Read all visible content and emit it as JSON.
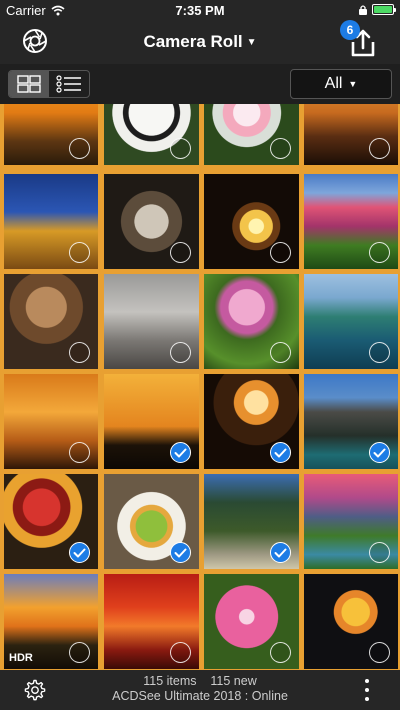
{
  "status": {
    "carrier": "Carrier",
    "time": "7:35 PM"
  },
  "nav": {
    "title": "Camera Roll",
    "share_badge": "6"
  },
  "toolbar": {
    "filter_label": "All"
  },
  "grid": {
    "tiles": [
      {
        "name": "sunset-tree",
        "bg": "linear-gradient(180deg,#f6a523 0%,#e27b14 45%,#5d3612 75%,#2a1b0a 100%)",
        "checked": false
      },
      {
        "name": "panda",
        "bg": "radial-gradient(circle at 50% 45%,#f7f7f4 0 32%,#1d1d1d 33% 40%,#f0f0ec 41% 55%,#2f4a22 56%)",
        "checked": false
      },
      {
        "name": "white-lilies",
        "bg": "radial-gradient(circle at 45% 45%,#fbeaf0 0 18%,#f4a9bd 19% 32%,#d9dfd8 33% 46%,#2b4a1c 47%)",
        "checked": false
      },
      {
        "name": "temple-sunset",
        "bg": "linear-gradient(180deg,#f3a33b 0%,#c76a1f 45%,#5a2d12 70%,#1b0e06 100%)",
        "checked": false
      },
      {
        "name": "golden-pagoda",
        "bg": "linear-gradient(180deg,#1a3a86 0%,#2b56b4 40%,#d79a26 60%,#7a4a13 100%)",
        "checked": false
      },
      {
        "name": "owl",
        "bg": "radial-gradient(circle at 50% 50%,#cfc6b8 0 25%,#5c4c3b 26% 45%,#1f1a15 46%)",
        "checked": false
      },
      {
        "name": "night-fountain",
        "bg": "radial-gradient(circle at 55% 55%,#fff4b0 0 10%,#f3c44a 11% 22%,#6a3a14 23% 32%,#130b06 33%)",
        "checked": false
      },
      {
        "name": "flower-garden",
        "bg": "linear-gradient(180deg,#4a7bc6 0%,#7ea6db 20%,#e05476 35%,#a3346a 55%,#3f7c22 75%,#1e4a15 100%)",
        "checked": false
      },
      {
        "name": "old-man-statue",
        "bg": "radial-gradient(circle at 45% 35%,#b98a5d 0 25%,#6e4a2c 26% 45%,#3a2a1e 46%)",
        "checked": false
      },
      {
        "name": "monkeys",
        "bg": "linear-gradient(180deg,#9a9a98 0%,#c4c2be 40%,#7b7874 70%,#4a4744 100%)",
        "checked": false
      },
      {
        "name": "pink-blossom-tree",
        "bg": "radial-gradient(circle at 45% 35%,#f0a9cf 0 22%,#c55aa0 23% 32%,#3d6a1f 40%,#57902b 70%,#1f3a10 100%)",
        "checked": false
      },
      {
        "name": "coastline-cliffs",
        "bg": "linear-gradient(180deg,#9dc0e0 0%,#7aa8cf 25%,#2e7e73 45%,#1a5b73 70%,#0f3d52 100%)",
        "checked": false
      },
      {
        "name": "sunset-rays",
        "bg": "linear-gradient(180deg,#d97a1a 0%,#f3a83a 40%,#b65c17 70%,#2e1607 100%)",
        "checked": false
      },
      {
        "name": "pointed-building-sunset",
        "bg": "linear-gradient(180deg,#f3b13a 0%,#e4851f 55%,#1c1208 75%,#0c0804 100%)",
        "checked": true
      },
      {
        "name": "sky-lanterns",
        "bg": "radial-gradient(circle at 55% 30%,#ffe1a0 0 14%,#e7902e 15% 26%,#3a1f0c 27% 50%,#150b05 51%)",
        "checked": true
      },
      {
        "name": "karst-cliffs",
        "bg": "linear-gradient(180deg,#3d78c7 0%,#5a8dc9 25%,#4b4b47 40%,#25302a 65%,#1e6c73 85%,#17515a 100%)",
        "checked": true
      },
      {
        "name": "fruit-plate",
        "bg": "radial-gradient(circle at 40% 35%,#d7342e 0 22%,#8c1a14 23% 34%,#e9a22f 35% 48%,#2b1f12 49%)",
        "checked": true
      },
      {
        "name": "salad",
        "bg": "radial-gradient(circle at 50% 55%,#8fbf3c 0 22%,#e5a83e 23% 30%,#f2efe6 31% 48%,#6a5a46 49%)",
        "checked": true
      },
      {
        "name": "mountain-beach",
        "bg": "linear-gradient(180deg,#3c6db3 0%,#2a4a33 30%,#3d5a2a 60%,#9f9a84 85%,#cfc7aa 100%)",
        "checked": true
      },
      {
        "name": "pink-sky-river",
        "bg": "linear-gradient(180deg,#e85b78 0%,#b04a8a 25%,#4f5d86 45%,#3f7a2a 65%,#3b8aa3 85%,#2e6d28 100%)",
        "checked": false
      },
      {
        "name": "ocean-sunset-hdr",
        "bg": "linear-gradient(180deg,#6b7dbc 0%,#f2a12e 35%,#e0721a 55%,#2b2210 75%,#120c06 100%)",
        "checked": false,
        "hdr": "HDR"
      },
      {
        "name": "red-clouds",
        "bg": "linear-gradient(180deg,#b81d14 0%,#e0401c 35%,#f27a2a 55%,#8a1a10 80%,#3a0a06 100%)",
        "checked": false
      },
      {
        "name": "pink-hibiscus",
        "bg": "radial-gradient(circle at 45% 45%,#f8d4e4 0 10%,#e9619e 11% 42%,#365e1d 43%)",
        "checked": false
      },
      {
        "name": "goldfish",
        "bg": "radial-gradient(circle at 55% 40%,#f7c13a 0 18%,#e6862a 19% 28%,#0f0f12 29%)",
        "checked": false
      }
    ]
  },
  "footer": {
    "counts": "115 items    115 new",
    "app_status": "ACDSee Ultimate 2018 : Online"
  }
}
